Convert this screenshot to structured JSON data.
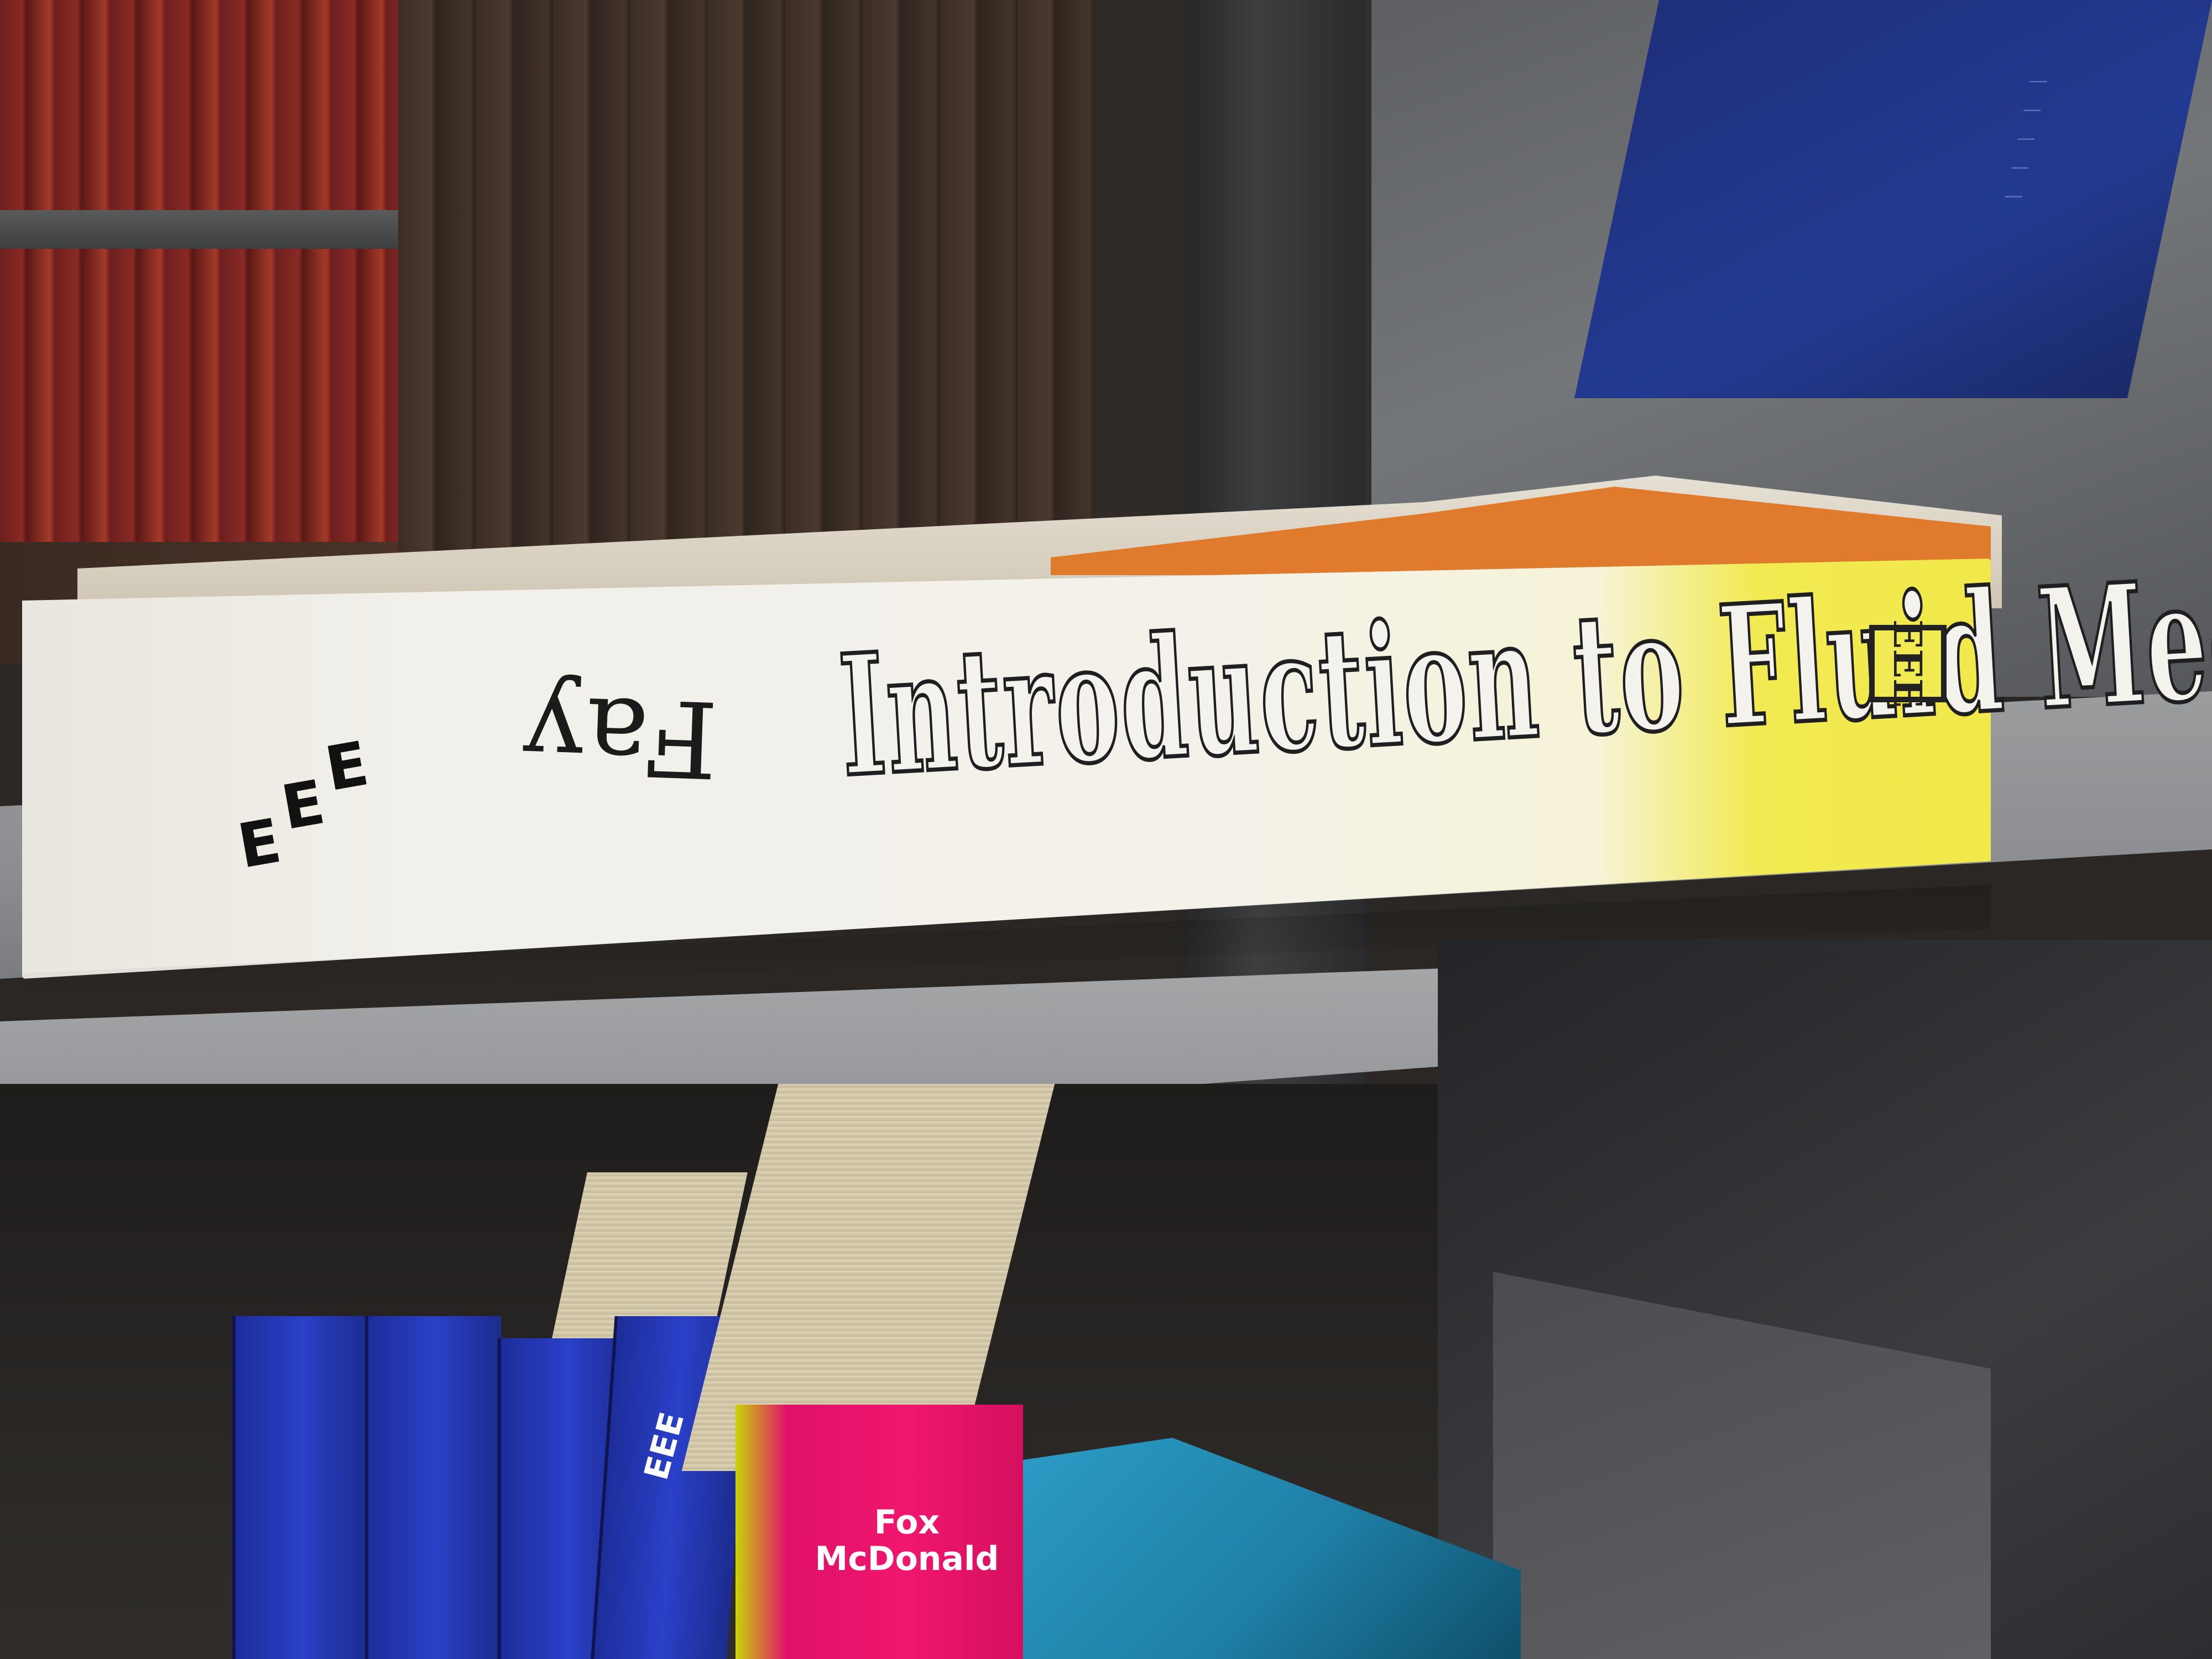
{
  "scene": "Library shelf with a book lying flat, spine facing the viewer",
  "main_book": {
    "title": "Introduction to Fluid Mechanics",
    "author": "Fay",
    "series_logo_letters": [
      "E",
      "E",
      "E"
    ],
    "publisher_mark": "EEE",
    "spine_colors": {
      "body": "#f2f0ea",
      "accent": "#f1e84a",
      "cover": "#e07a2c"
    }
  },
  "lower_books": {
    "fox_book_author": "Fox\nMcDonald",
    "eee_label": "EEE",
    "colors": {
      "blue": "#2a40c8",
      "pink": "#f0176e",
      "teal": "#1f7fa6"
    }
  }
}
